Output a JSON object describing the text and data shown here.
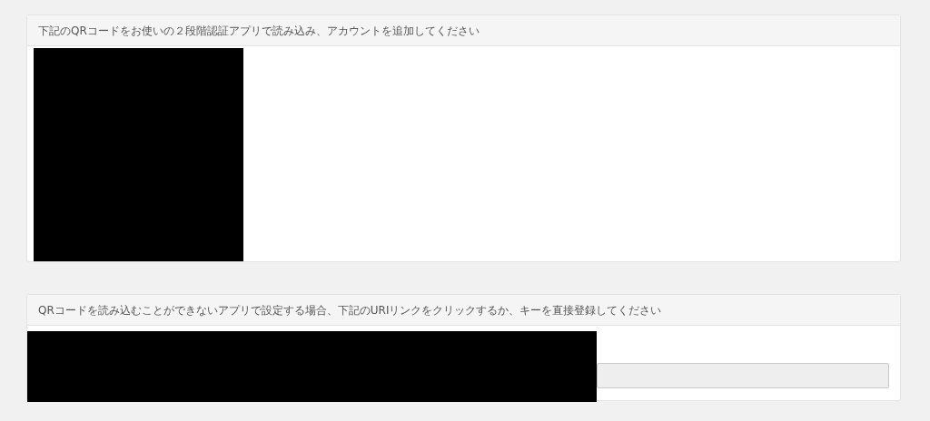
{
  "qr_panel": {
    "header": "下記のQRコードをお使いの２段階認証アプリで読み込み、アカウントを追加してください"
  },
  "uri_panel": {
    "header": "QRコードを読み込むことができないアプリで設定する場合、下記のURIリンクをクリックするか、キーを直接登録してください",
    "key_field": {
      "disabled": true
    }
  }
}
